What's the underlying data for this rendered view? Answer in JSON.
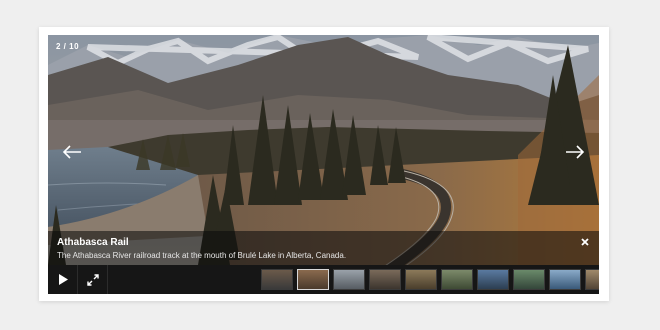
{
  "gallery": {
    "counter": "2 / 10",
    "caption": {
      "title": "Athabasca Rail",
      "description": "The Athabasca River railroad track at the mouth of Brulé Lake in Alberta, Canada."
    },
    "icons": {
      "prev": "arrow-left-icon",
      "next": "arrow-right-icon",
      "close": "close-icon",
      "play": "play-icon",
      "fullscreen": "fullscreen-icon"
    },
    "thumbnails": [
      {
        "colors": [
          "#6b5a4a",
          "#3a3a3a"
        ]
      },
      {
        "colors": [
          "#8a6a4e",
          "#4a3a2c"
        ],
        "active": true
      },
      {
        "colors": [
          "#9aa2aa",
          "#565c62"
        ]
      },
      {
        "colors": [
          "#7a6a5a",
          "#3c352e"
        ]
      },
      {
        "colors": [
          "#8c7a5a",
          "#4a3e2c"
        ]
      },
      {
        "colors": [
          "#7c8a6a",
          "#3e4a34"
        ]
      },
      {
        "colors": [
          "#5a7aa0",
          "#2c3e52"
        ]
      },
      {
        "colors": [
          "#6a8a6a",
          "#34463a"
        ]
      },
      {
        "colors": [
          "#8aaac8",
          "#3a5a7a"
        ]
      },
      {
        "colors": [
          "#a08a6a",
          "#524436"
        ]
      }
    ]
  }
}
